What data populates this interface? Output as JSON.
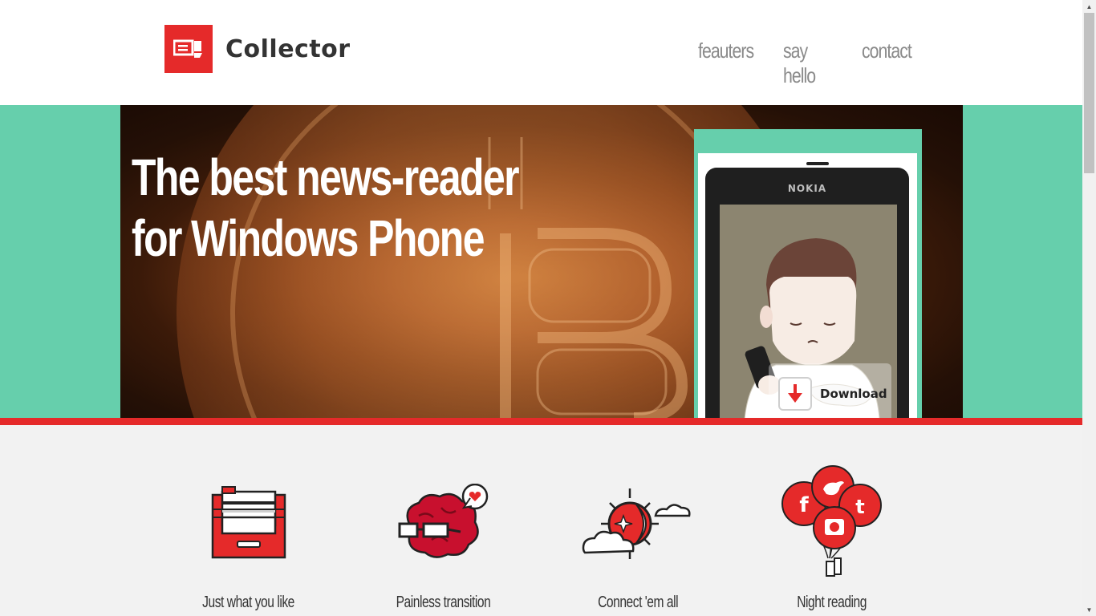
{
  "header": {
    "brand_name": "Collector",
    "nav": [
      {
        "label": "feauters"
      },
      {
        "label": "say hello"
      },
      {
        "label": "contact"
      }
    ]
  },
  "hero": {
    "headline_line1": "The best news-reader",
    "headline_line2": "for Windows Phone",
    "phone_brand": "NOKIA",
    "download_label": "Download"
  },
  "features": [
    {
      "caption": "Just what you like",
      "icon": "file-cabinet-icon"
    },
    {
      "caption": "Painless transition",
      "icon": "brain-glasses-icon"
    },
    {
      "caption": "Connect 'em all",
      "icon": "sun-moon-clouds-icon"
    },
    {
      "caption": "Night reading",
      "icon": "social-balloons-icon"
    }
  ],
  "colors": {
    "accent": "#e52a2a",
    "teal": "#66cfac",
    "header_text": "#333333",
    "nav_text": "#8a8a8a",
    "feature_bg": "#f2f2f2"
  }
}
